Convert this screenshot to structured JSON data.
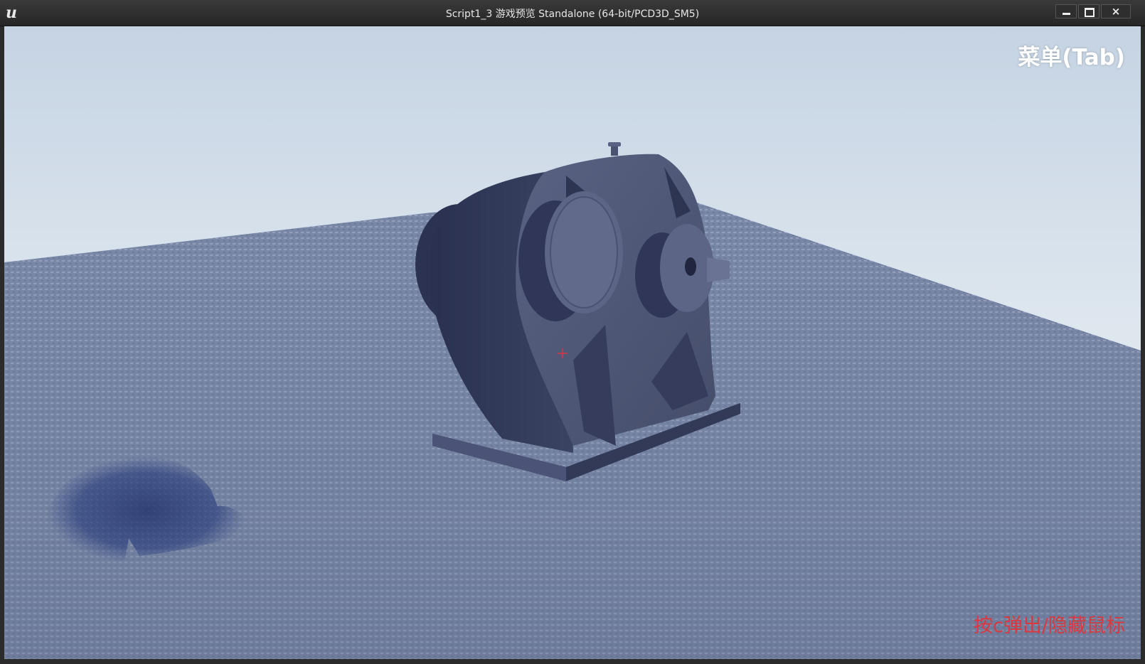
{
  "window": {
    "title": "Script1_3 游戏预览 Standalone (64-bit/PCD3D_SM5)",
    "app_icon": "unreal-engine-logo",
    "controls": {
      "minimize": "minimize-icon",
      "maximize": "maximize-icon",
      "close": "×"
    }
  },
  "hud": {
    "menu_label": "菜单(Tab)",
    "cursor_hint": "按c弹出/隐藏鼠标",
    "crosshair_icon": "crosshair-icon"
  },
  "colors": {
    "hint_text": "#d9393e",
    "menu_text": "#ffffff",
    "floor": "#7d8aa8",
    "model": "#4a5270"
  }
}
